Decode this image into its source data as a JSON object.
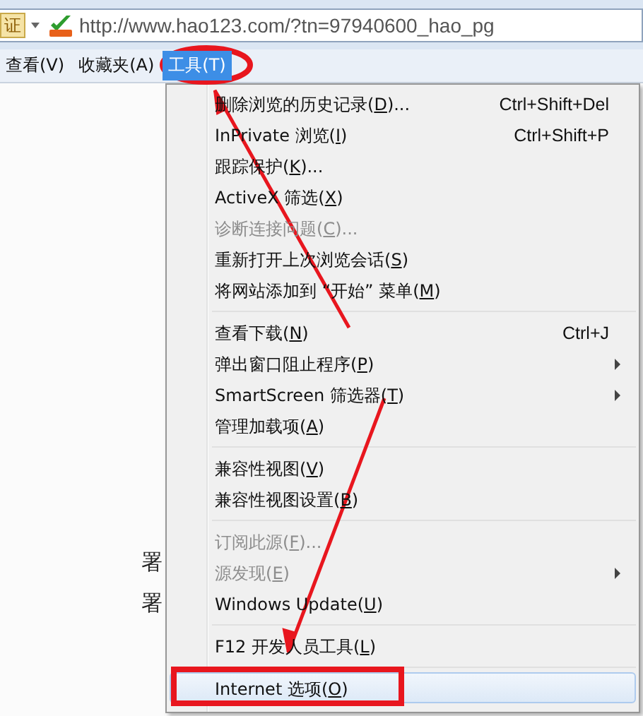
{
  "address_bar": {
    "cert_label": "证",
    "url": "http://www.hao123.com/?tn=97940600_hao_pg"
  },
  "menu_bar": [
    {
      "label": "查看(V)",
      "selected": false
    },
    {
      "label": "收藏夹(A)",
      "selected": false
    },
    {
      "label": "工具(T)",
      "selected": true
    }
  ],
  "page_fragments": [
    "署",
    "署"
  ],
  "menu": {
    "items": [
      {
        "kind": "item",
        "text": "删除浏览的历史记录(",
        "key": "D",
        "tail": ")...",
        "shortcut": "Ctrl+Shift+Del",
        "disabled": false,
        "submenu": false,
        "selected": false
      },
      {
        "kind": "item",
        "text": "InPrivate 浏览(",
        "key": "I",
        "tail": ")",
        "shortcut": "Ctrl+Shift+P",
        "disabled": false,
        "submenu": false,
        "selected": false
      },
      {
        "kind": "item",
        "text": "跟踪保护(",
        "key": "K",
        "tail": ")...",
        "disabled": false,
        "submenu": false,
        "selected": false
      },
      {
        "kind": "item",
        "text": "ActiveX 筛选(",
        "key": "X",
        "tail": ")",
        "disabled": false,
        "submenu": false,
        "selected": false
      },
      {
        "kind": "item",
        "text": "诊断连接问题(",
        "key": "C",
        "tail": ")...",
        "disabled": true,
        "submenu": false,
        "selected": false
      },
      {
        "kind": "item",
        "text": "重新打开上次浏览会话(",
        "key": "S",
        "tail": ")",
        "disabled": false,
        "submenu": false,
        "selected": false
      },
      {
        "kind": "item",
        "text": "将网站添加到 “开始” 菜单(",
        "key": "M",
        "tail": ")",
        "disabled": false,
        "submenu": false,
        "selected": false
      },
      {
        "kind": "separator"
      },
      {
        "kind": "item",
        "text": "查看下载(",
        "key": "N",
        "tail": ")",
        "shortcut": "Ctrl+J",
        "disabled": false,
        "submenu": false,
        "selected": false
      },
      {
        "kind": "item",
        "text": "弹出窗口阻止程序(",
        "key": "P",
        "tail": ")",
        "disabled": false,
        "submenu": true,
        "selected": false
      },
      {
        "kind": "item",
        "text": "SmartScreen 筛选器(",
        "key": "T",
        "tail": ")",
        "disabled": false,
        "submenu": true,
        "selected": false
      },
      {
        "kind": "item",
        "text": "管理加载项(",
        "key": "A",
        "tail": ")",
        "disabled": false,
        "submenu": false,
        "selected": false
      },
      {
        "kind": "separator"
      },
      {
        "kind": "item",
        "text": "兼容性视图(",
        "key": "V",
        "tail": ")",
        "disabled": false,
        "submenu": false,
        "selected": false
      },
      {
        "kind": "item",
        "text": "兼容性视图设置(",
        "key": "B",
        "tail": ")",
        "disabled": false,
        "submenu": false,
        "selected": false
      },
      {
        "kind": "separator"
      },
      {
        "kind": "item",
        "text": "订阅此源(",
        "key": "F",
        "tail": ")...",
        "disabled": true,
        "submenu": false,
        "selected": false
      },
      {
        "kind": "item",
        "text": "源发现(",
        "key": "E",
        "tail": ")",
        "disabled": true,
        "submenu": true,
        "selected": false
      },
      {
        "kind": "item",
        "text": "Windows Update(",
        "key": "U",
        "tail": ")",
        "disabled": false,
        "submenu": false,
        "selected": false
      },
      {
        "kind": "separator"
      },
      {
        "kind": "item",
        "text": "F12 开发人员工具(",
        "key": "L",
        "tail": ")",
        "disabled": false,
        "submenu": false,
        "selected": false
      },
      {
        "kind": "separator"
      },
      {
        "kind": "item",
        "text": "Internet 选项(",
        "key": "O",
        "tail": ")",
        "disabled": false,
        "submenu": false,
        "selected": true
      }
    ]
  }
}
